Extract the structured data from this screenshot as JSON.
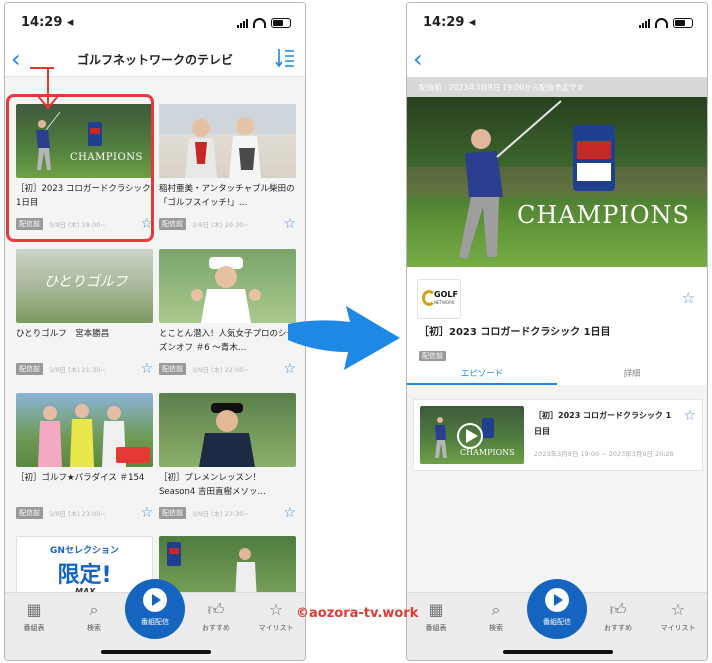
{
  "status": {
    "time": "14:29 ◂"
  },
  "left": {
    "title": "ゴルフネットワークのテレビ",
    "cards": [
      {
        "title": "［初］2023 コロガードクラシック 1日目",
        "badge": "配信前",
        "date": "3/9日 (木) 19:00~"
      },
      {
        "title": "稲村亜美・アンタッチャブル柴田の「ゴルフスイッチ!」…",
        "badge": "配信前",
        "date": "3/9日 (木) 20:30~"
      },
      {
        "title": "ひとりゴルフ　宮本勝昌",
        "badge": "配信前",
        "date": "3/9日 (木) 21:30~"
      },
      {
        "title": "とことん潜入！人気女子プロのシーズンオフ ＃6 ～青木…",
        "badge": "配信前",
        "date": "3/9日 (木) 22:00~"
      },
      {
        "title": "［初］ゴルフ★パラダイス ＃154",
        "badge": "配信前",
        "date": "3/9日 (木) 23:00~"
      },
      {
        "title": "［初］プレメンレッスン！Season4 吉田直樹メソッ…",
        "badge": "配信前",
        "date": "3/9日 (木) 23:30~"
      }
    ],
    "thumb_texts": {
      "champions": "CHAMPIONS",
      "hitori": "ひとりゴルフ",
      "gn_selection": "GNセレクション",
      "gentei": "限定!",
      "max": "MAX"
    }
  },
  "tabbar": {
    "items": [
      "番組表",
      "検索",
      "番組配信",
      "おすすめ",
      "マイリスト"
    ]
  },
  "right": {
    "notice": "配信前　2023年3月9日 19:00から配信予定です",
    "hero_text": "CHAMPIONS",
    "logo": {
      "big": "GOLF",
      "small": "NETWORK"
    },
    "title": "［初］2023 コロガードクラシック 1日目",
    "badge": "配信前",
    "tabs": [
      "エピソード",
      "詳細"
    ],
    "episode": {
      "title": "［初］2023 コロガードクラシック 1日目",
      "date": "2023年3月9日 19:00 ~ 2023年3月9日 20:28"
    }
  },
  "watermark": "©aozora-tv.work",
  "colors": {
    "accent": "#1e88e5",
    "highlight": "#e53935",
    "arrow": "#1e88e5",
    "fab": "#1565c0"
  }
}
